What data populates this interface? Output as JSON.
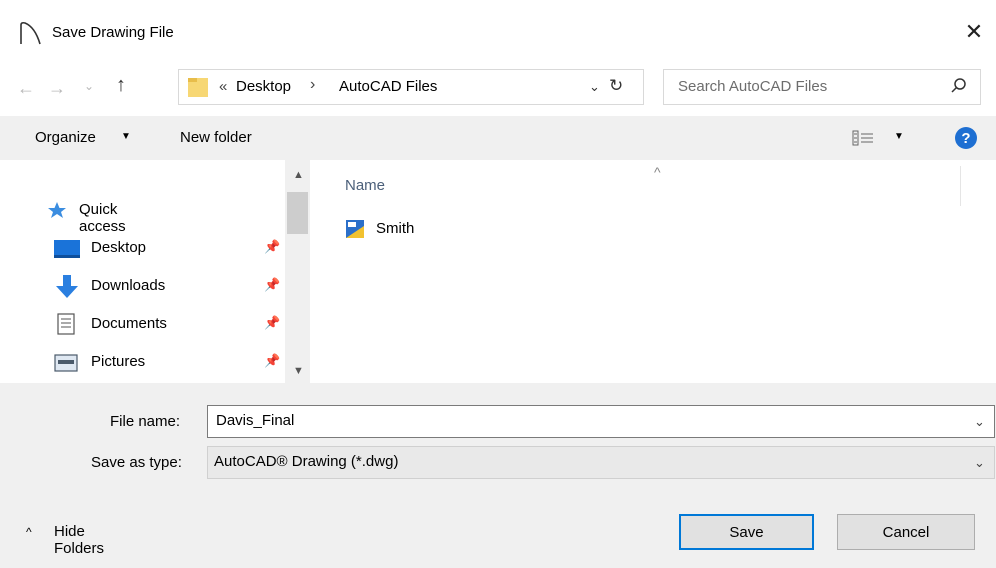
{
  "window": {
    "title": "Save Drawing File",
    "close_glyph": "✕"
  },
  "nav": {
    "back_glyph": "←",
    "forward_glyph": "→",
    "recent_glyph": "⌄",
    "up_glyph": "↑"
  },
  "address": {
    "overflow": "«",
    "crumbs": [
      "Desktop",
      "AutoCAD Files"
    ],
    "separator": "›",
    "dropdown_glyph": "⌄",
    "refresh_glyph": "↻"
  },
  "search": {
    "placeholder": "Search AutoCAD Files"
  },
  "toolbar": {
    "organize": "Organize",
    "caret": "▼",
    "new_folder": "New folder",
    "help": "?"
  },
  "sidebar": {
    "items": [
      {
        "label": "Quick access",
        "icon": "star-icon"
      },
      {
        "label": "Desktop",
        "icon": "desktop-icon",
        "pin": "📌"
      },
      {
        "label": "Downloads",
        "icon": "download-icon",
        "pin": "📌"
      },
      {
        "label": "Documents",
        "icon": "documents-icon",
        "pin": "📌"
      },
      {
        "label": "Pictures",
        "icon": "pictures-icon",
        "pin": "📌"
      }
    ],
    "scroll_up": "▲",
    "scroll_down": "▼"
  },
  "files": {
    "column_name": "Name",
    "sort_glyph": "^",
    "rows": [
      {
        "name": "Smith",
        "icon": "dwg-file-icon"
      }
    ]
  },
  "form": {
    "file_name_label": "File name:",
    "file_name_value": "Davis_Final",
    "save_type_label": "Save as type:",
    "save_type_value": "AutoCAD® Drawing (*.dwg)",
    "caret": "⌄"
  },
  "footer": {
    "hide_folders_glyph": "^",
    "hide_folders": "Hide Folders",
    "save": "Save",
    "cancel": "Cancel"
  },
  "colors": {
    "accent": "#0078d7",
    "toolbar_bg": "#f0f0f0",
    "help": "#1e6fd2"
  }
}
